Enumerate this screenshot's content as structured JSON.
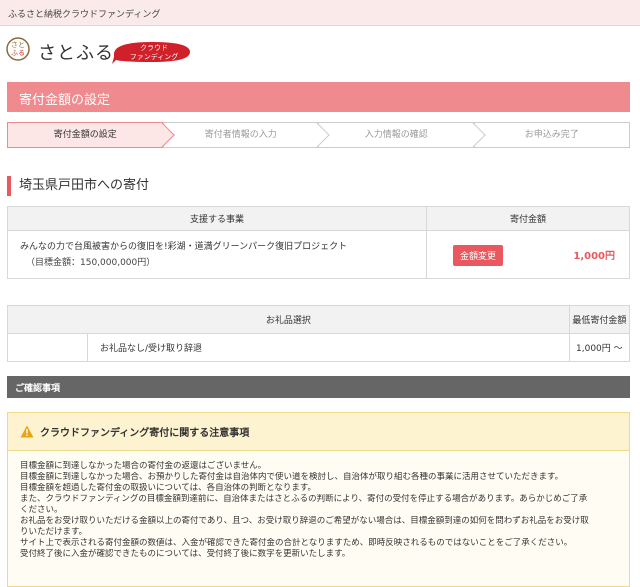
{
  "topbar": {
    "text": "ふるさと納税クラウドファンディング"
  },
  "brand": {
    "name": "さとふる",
    "badge_line1": "クラウド",
    "badge_line2": "ファンディング"
  },
  "page": {
    "title": "寄付金額の設定"
  },
  "steps": [
    {
      "label": "寄付金額の設定",
      "active": true
    },
    {
      "label": "寄付者情報の入力",
      "active": false
    },
    {
      "label": "入力情報の確認",
      "active": false
    },
    {
      "label": "お申込み完了",
      "active": false
    }
  ],
  "city": {
    "title": "埼玉県戸田市への寄付"
  },
  "project_table": {
    "col_project": "支援する事業",
    "col_amount": "寄付金額",
    "project_name": "みんなの力で台風被害からの復旧を!彩湖・道満グリーンパーク復旧プロジェクト",
    "project_goal": "（目標金額：150,000,000円）",
    "change_button": "金額変更",
    "amount": "1,000円"
  },
  "gift_table": {
    "col_gift": "お礼品選択",
    "col_min": "最低寄付金額",
    "gift_name": "お礼品なし/受け取り辞退",
    "min_amount": "1,000円 〜"
  },
  "confirm": {
    "label": "ご確認事項"
  },
  "notice": {
    "title": "クラウドファンディング寄付に関する注意事項",
    "lines": [
      "目標金額に到達しなかった場合の寄付金の返還はございません。",
      "目標金額に到達しなかった場合、お預かりした寄付金は自治体内で使い道を検討し、自治体が取り組む各種の事業に活用させていただきます。",
      "目標金額を超過した寄付金の取扱いについては、各自治体の判断となります。",
      "また、クラウドファンディングの目標金額到達前に、自治体またはさとふるの判断により、寄付の受付を停止する場合があります。あらかじめご了承",
      "ください。",
      "お礼品をお受け取りいただける金額以上の寄付であり、且つ、お受け取り辞退のご希望がない場合は、目標金額到達の如何を問わずお礼品をお受け取",
      "りいただけます。",
      "サイト上で表示される寄付金額の数値は、入金が確認できた寄付金の合計となりますため、即時反映されるものではないことをご了承ください。",
      "受付終了後に入金が確認できたものについては、受付終了後に数字を更新いたします。"
    ]
  },
  "colors": {
    "accent": "#ef8a8e",
    "red": "#e8585e",
    "notice_bg": "#fffdf3",
    "dark_bar": "#666666"
  }
}
